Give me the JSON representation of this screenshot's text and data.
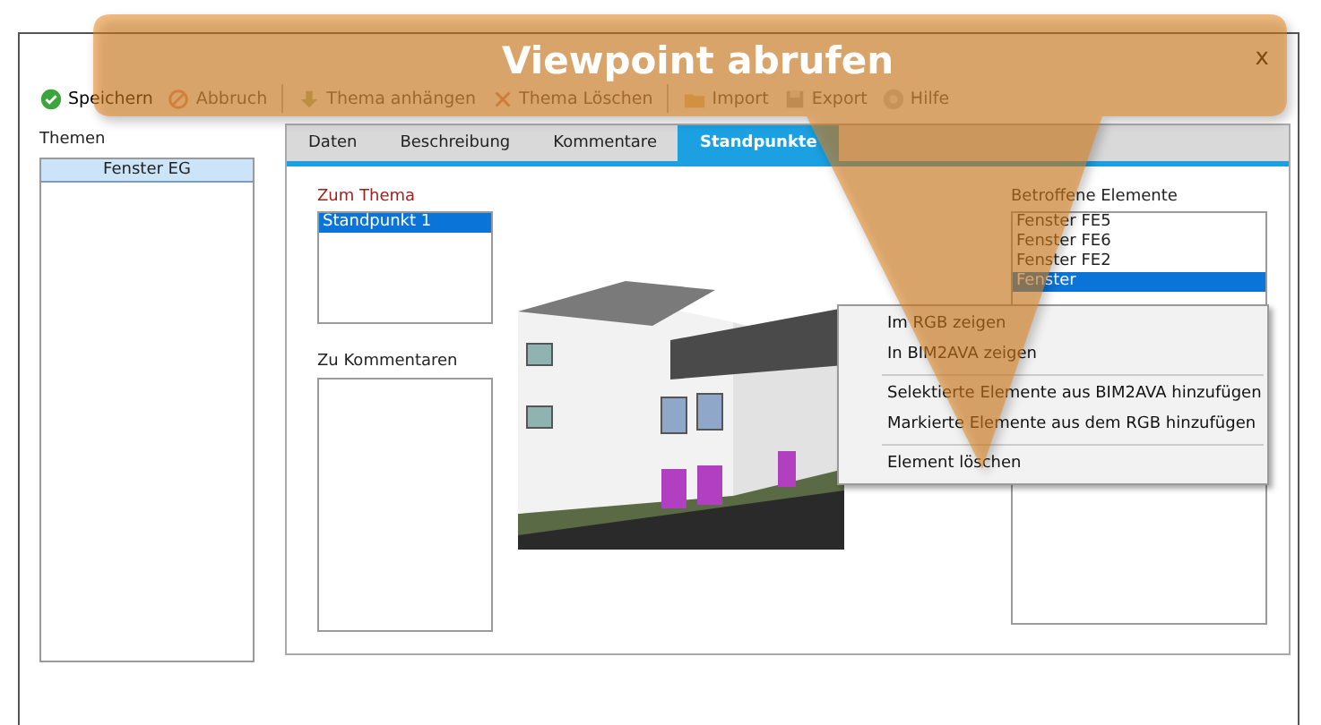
{
  "window": {
    "close": "x"
  },
  "toolbar": [
    {
      "label": "Speichern",
      "disabled": false
    },
    {
      "label": "Abbruch",
      "disabled": true
    },
    {
      "label": "Thema anhängen",
      "disabled": true
    },
    {
      "label": "Thema Löschen",
      "disabled": true
    },
    {
      "label": "Import",
      "disabled": true
    },
    {
      "label": "Export",
      "disabled": true
    },
    {
      "label": "Hilfe",
      "disabled": true
    }
  ],
  "sidebar": {
    "title": "Themen",
    "items": [
      {
        "label": "Fenster EG",
        "selected": true
      }
    ]
  },
  "tabs": [
    {
      "label": "Daten",
      "selected": false
    },
    {
      "label": "Beschreibung",
      "selected": false
    },
    {
      "label": "Kommentare",
      "selected": false
    },
    {
      "label": "Standpunkte",
      "selected": true
    }
  ],
  "zum_thema": {
    "label": "Zum Thema",
    "items": [
      {
        "label": "Standpunkt 1",
        "selected": true
      }
    ]
  },
  "zu_kommentaren": {
    "label": "Zu Kommentaren"
  },
  "betroffene_elemente": {
    "label": "Betroffene Elemente",
    "items": [
      {
        "label": "Fenster FE5",
        "selected": false
      },
      {
        "label": "Fenster FE6",
        "selected": false
      },
      {
        "label": "Fenster FE2",
        "selected": false
      },
      {
        "label": "Fenster",
        "selected": true
      }
    ]
  },
  "context_menu": {
    "items": [
      {
        "kind": "item",
        "label": "Im RGB zeigen"
      },
      {
        "kind": "item",
        "label": "In BIM2AVA zeigen"
      },
      {
        "kind": "separator"
      },
      {
        "kind": "item",
        "label": "Selektierte Elemente aus BIM2AVA hinzufügen"
      },
      {
        "kind": "item",
        "label": "Markierte Elemente aus dem RGB hinzufügen"
      },
      {
        "kind": "separator"
      },
      {
        "kind": "item",
        "label": "Element löschen"
      }
    ]
  },
  "callout": {
    "text": "Viewpoint abrufen"
  }
}
